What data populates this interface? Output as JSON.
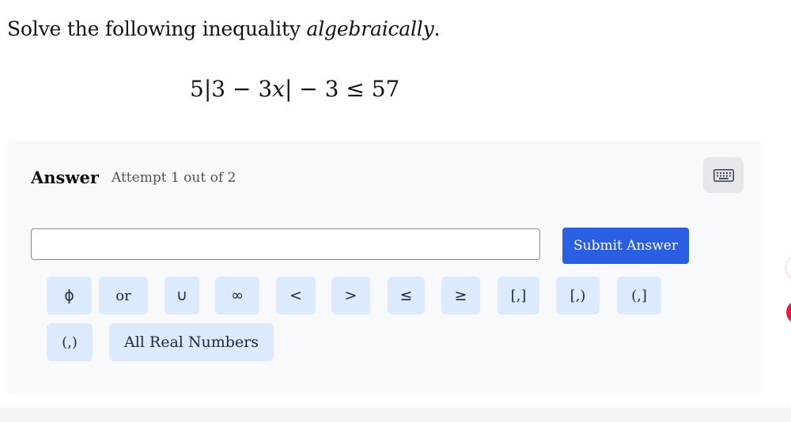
{
  "question": {
    "prefix": "Solve the following inequality ",
    "emphasis": "algebraically",
    "suffix": "."
  },
  "formula": {
    "part1": "5|3 − 3",
    "variable": "x",
    "part2": "| − 3 ≤ 57"
  },
  "answer": {
    "label": "Answer",
    "attempt": "Attempt 1 out of 2",
    "input_value": "",
    "input_placeholder": "",
    "submit_label": "Submit Answer"
  },
  "keypad": {
    "row1": [
      "ϕ",
      "or",
      "∪",
      "∞",
      "<",
      ">",
      "≤",
      "≥",
      "[,]",
      "[,)",
      "(,]"
    ],
    "row2": [
      "(,)",
      "All Real Numbers"
    ]
  },
  "icons": {
    "keyboard": "keyboard-icon"
  },
  "colors": {
    "accent": "#2a5fe3",
    "key_bg": "#dbeafe",
    "panel_bg": "#f7f9fb"
  }
}
